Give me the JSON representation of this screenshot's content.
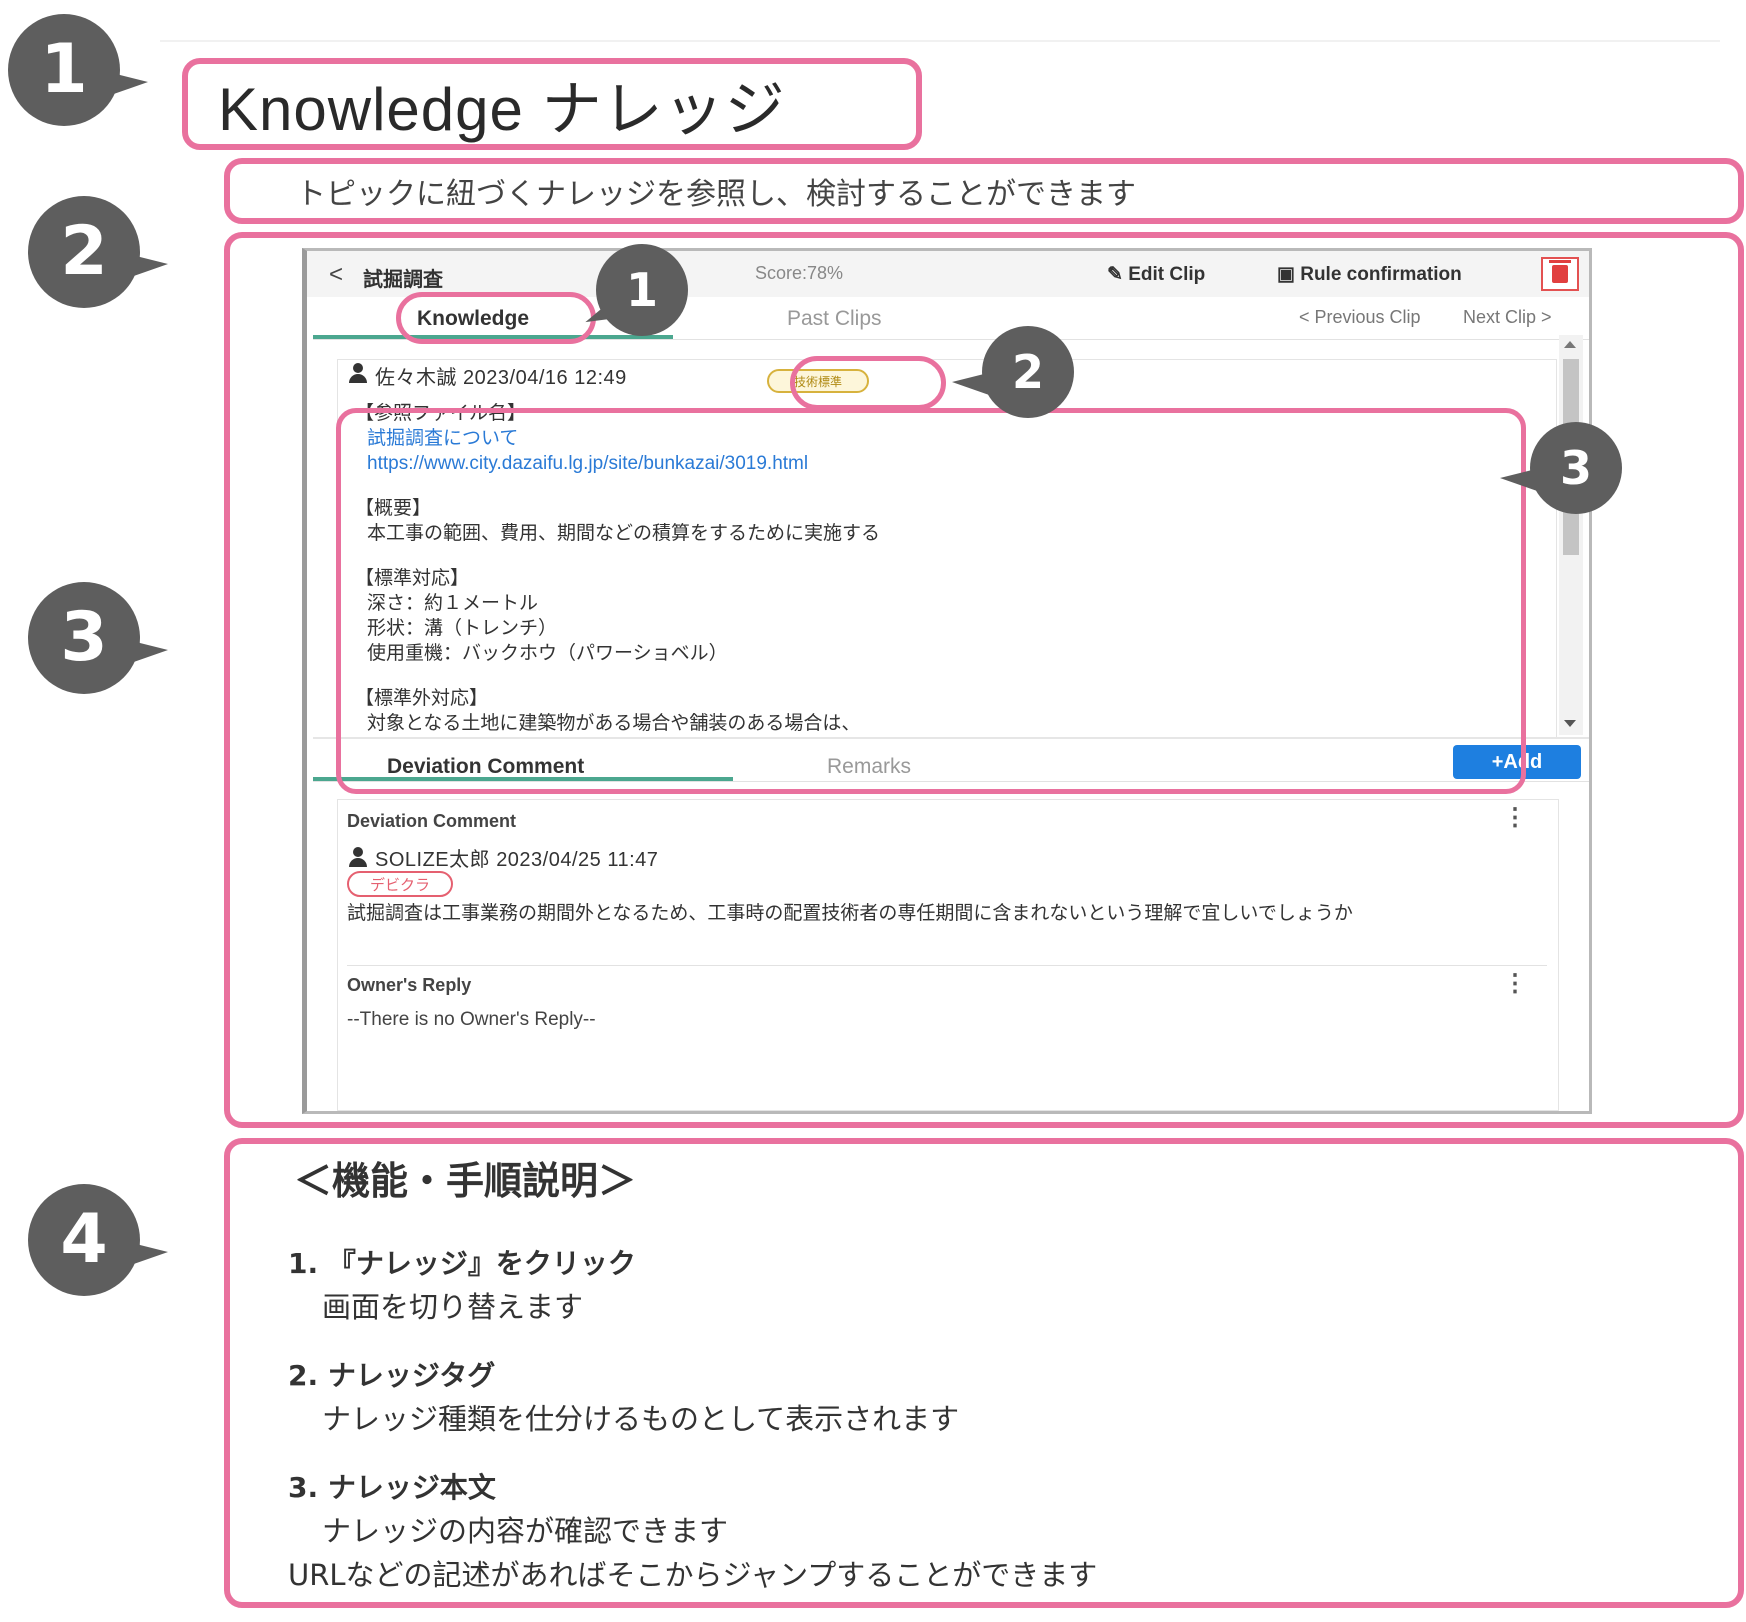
{
  "callouts": {
    "c1": "1",
    "c2": "2",
    "c3": "3",
    "c4": "4"
  },
  "header": {
    "title": "Knowledge ナレッジ",
    "subtitle": "トピックに紐づくナレッジを参照し、検討することができます"
  },
  "screen": {
    "back_glyph": "<",
    "topic_title": "試掘調査",
    "score": "Score:78%",
    "edit_clip": "Edit Clip",
    "rule_confirmation": "Rule confirmation",
    "tabs": {
      "knowledge": "Knowledge",
      "past_clips": "Past Clips"
    },
    "previous_clip": "< Previous Clip",
    "next_clip": "Next Clip >",
    "knowledge_card": {
      "author": "佐々木誠 2023/04/16 12:49",
      "tag": "技術標準",
      "lines": {
        "l1": "【参照ファイル名】",
        "l2": "試掘調査について",
        "l3": "https://www.city.dazaifu.lg.jp/site/bunkazai/3019.html",
        "l4": "【概要】",
        "l5": "本工事の範囲、費用、期間などの積算をするために実施する",
        "l6": "【標準対応】",
        "l7": "深さ：約１メートル",
        "l8": "形状：溝（トレンチ）",
        "l9": "使用重機：バックホウ（パワーショベル）",
        "l10": "【標準外対応】",
        "l11": "対象となる土地に建築物がある場合や舗装のある場合は、"
      }
    },
    "comment_tabs": {
      "deviation": "Deviation Comment",
      "remarks": "Remarks"
    },
    "add_button": "+Add",
    "comment_card": {
      "title": "Deviation Comment",
      "author": "SOLIZE太郎 2023/04/25 11:47",
      "tag": "デビクラ",
      "text": "試掘調査は工事業務の期間外となるため、工事時の配置技術者の専任期間に含まれないという理解で宜しいでしょうか",
      "reply_title": "Owner's Reply",
      "reply_text": "--There is no Owner's Reply--",
      "menu_glyph": "⋮"
    },
    "inner_callouts": {
      "i1": "1",
      "i2": "2",
      "i3": "3"
    }
  },
  "howto": {
    "heading": "＜機能・手順説明＞",
    "steps": [
      {
        "title": "1. 『ナレッジ』をクリック",
        "desc": "画面を切り替えます"
      },
      {
        "title": "2. ナレッジタグ",
        "desc": "ナレッジ種類を仕分けるものとして表示されます"
      },
      {
        "title": "3. ナレッジ本文",
        "desc": "ナレッジの内容が確認できます",
        "desc2": "URLなどの記述があればそこからジャンプすることができます"
      }
    ]
  },
  "colors": {
    "accent_pink": "#e9719e",
    "callout_gray": "#5e5e5e",
    "tab_green": "#4ba78f",
    "add_blue": "#1e7fe0"
  }
}
